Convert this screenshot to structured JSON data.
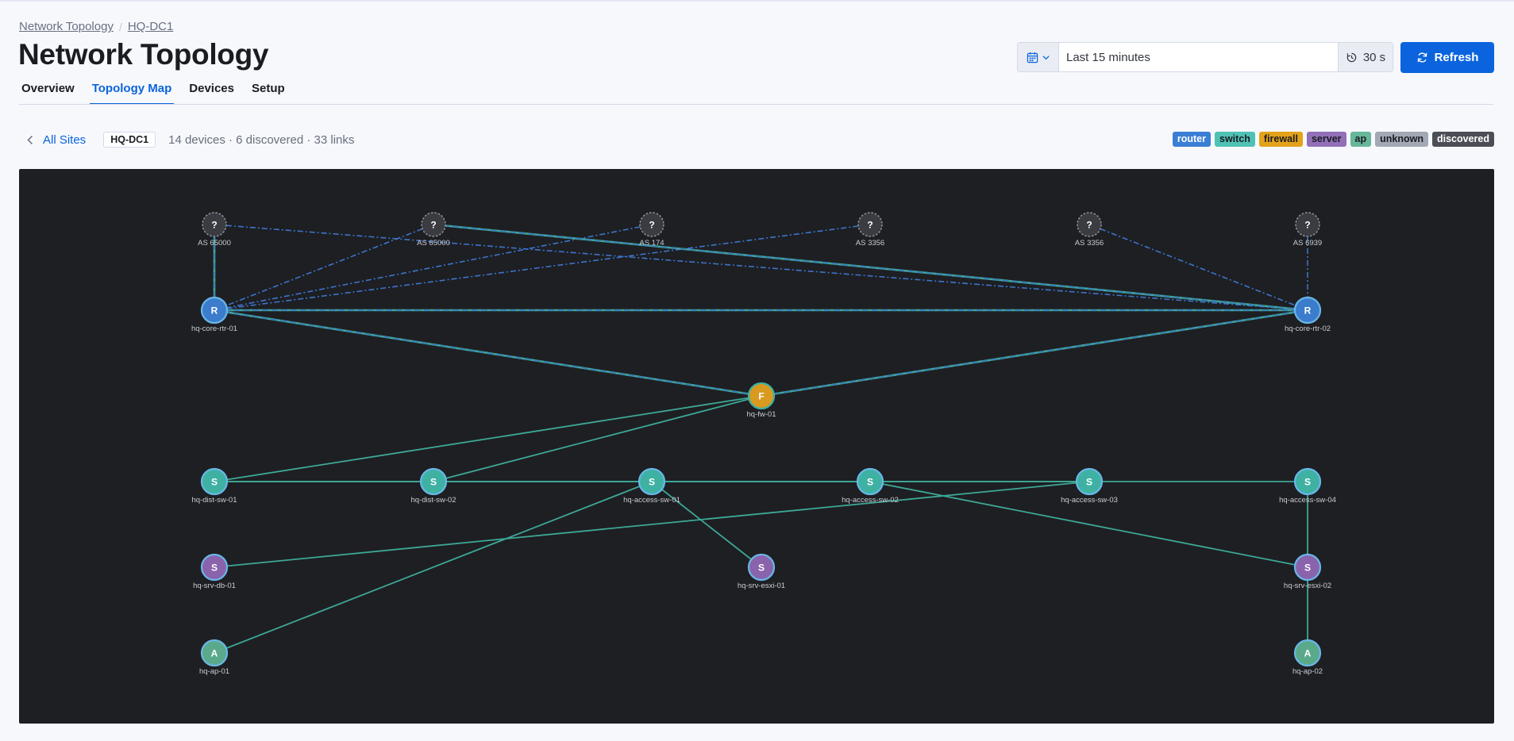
{
  "breadcrumb": {
    "root": "Network Topology",
    "current": "HQ-DC1"
  },
  "page": {
    "title": "Network Topology"
  },
  "tabs": [
    {
      "label": "Overview"
    },
    {
      "label": "Topology Map",
      "active": true
    },
    {
      "label": "Devices"
    },
    {
      "label": "Setup"
    }
  ],
  "time_picker": {
    "range": "Last 15 minutes",
    "interval": "30 s",
    "calendar_icon": "calendar-icon",
    "refresh_interval_icon": "timer-icon"
  },
  "refresh_button": {
    "label": "Refresh",
    "icon": "refresh-icon"
  },
  "site_bar": {
    "back_label": "All Sites",
    "site": "HQ-DC1",
    "summary": "14 devices · 6 discovered · 33 links"
  },
  "legend": [
    {
      "label": "router",
      "bg": "#3a7fd5",
      "fg": "#ffffff"
    },
    {
      "label": "switch",
      "bg": "#4fc1b5",
      "fg": "#1a1c21"
    },
    {
      "label": "firewall",
      "bg": "#e3a21a",
      "fg": "#1a1c21"
    },
    {
      "label": "server",
      "bg": "#9170b8",
      "fg": "#1a1c21"
    },
    {
      "label": "ap",
      "bg": "#67b79a",
      "fg": "#1a1c21"
    },
    {
      "label": "unknown",
      "bg": "#a2a9b5",
      "fg": "#1a1c21"
    },
    {
      "label": "discovered",
      "bg": "#4b4e55",
      "fg": "#ffffff"
    }
  ],
  "colors": {
    "router": "#3b7ccc",
    "switch": "#3fb1a3",
    "firewall": "#d99a1f",
    "server": "#8a63ad",
    "ap": "#5aa98b",
    "discovered": "#3a3c42",
    "link_physical": "#3da896",
    "link_bgp": "#3c74c8",
    "accent": "#0b64dd"
  },
  "topology": {
    "nodes": [
      {
        "id": "as1",
        "label": "AS 65000",
        "glyph": "?",
        "type": "discovered"
      },
      {
        "id": "as2",
        "label": "AS 65000",
        "glyph": "?",
        "type": "discovered"
      },
      {
        "id": "as3",
        "label": "AS 174",
        "glyph": "?",
        "type": "discovered"
      },
      {
        "id": "as4",
        "label": "AS 3356",
        "glyph": "?",
        "type": "discovered"
      },
      {
        "id": "as5",
        "label": "AS 3356",
        "glyph": "?",
        "type": "discovered"
      },
      {
        "id": "as6",
        "label": "AS 6939",
        "glyph": "?",
        "type": "discovered"
      },
      {
        "id": "r1",
        "label": "hq-core-rtr-01",
        "glyph": "R",
        "type": "router"
      },
      {
        "id": "r2",
        "label": "hq-core-rtr-02",
        "glyph": "R",
        "type": "router"
      },
      {
        "id": "fw",
        "label": "hq-fw-01",
        "glyph": "F",
        "type": "firewall"
      },
      {
        "id": "ds1",
        "label": "hq-dist-sw-01",
        "glyph": "S",
        "type": "switch"
      },
      {
        "id": "ds2",
        "label": "hq-dist-sw-02",
        "glyph": "S",
        "type": "switch"
      },
      {
        "id": "as01",
        "label": "hq-access-sw-01",
        "glyph": "S",
        "type": "switch"
      },
      {
        "id": "as02",
        "label": "hq-access-sw-02",
        "glyph": "S",
        "type": "switch"
      },
      {
        "id": "as03",
        "label": "hq-access-sw-03",
        "glyph": "S",
        "type": "switch"
      },
      {
        "id": "as04",
        "label": "hq-access-sw-04",
        "glyph": "S",
        "type": "switch"
      },
      {
        "id": "db1",
        "label": "hq-srv-db-01",
        "glyph": "S",
        "type": "server"
      },
      {
        "id": "esx1",
        "label": "hq-srv-esxi-01",
        "glyph": "S",
        "type": "server"
      },
      {
        "id": "esx2",
        "label": "hq-srv-esxi-02",
        "glyph": "S",
        "type": "server"
      },
      {
        "id": "ap1",
        "label": "hq-ap-01",
        "glyph": "A",
        "type": "ap"
      },
      {
        "id": "ap2",
        "label": "hq-ap-02",
        "glyph": "A",
        "type": "ap"
      }
    ],
    "links": [
      {
        "from": "as1",
        "to": "r1",
        "kind": "bgp"
      },
      {
        "from": "as1",
        "to": "r2",
        "kind": "bgp"
      },
      {
        "from": "as2",
        "to": "r1",
        "kind": "bgp"
      },
      {
        "from": "as2",
        "to": "r2",
        "kind": "bgp"
      },
      {
        "from": "as3",
        "to": "r1",
        "kind": "bgp"
      },
      {
        "from": "as4",
        "to": "r1",
        "kind": "bgp"
      },
      {
        "from": "as5",
        "to": "r2",
        "kind": "bgp"
      },
      {
        "from": "as6",
        "to": "r2",
        "kind": "bgp"
      },
      {
        "from": "as1",
        "to": "r1",
        "kind": "ha"
      },
      {
        "from": "as2",
        "to": "r2",
        "kind": "ha"
      },
      {
        "from": "r1",
        "to": "r2",
        "kind": "ha"
      },
      {
        "from": "r1",
        "to": "fw",
        "kind": "ha"
      },
      {
        "from": "r2",
        "to": "fw",
        "kind": "ha"
      },
      {
        "from": "fw",
        "to": "ds1",
        "kind": "phys"
      },
      {
        "from": "fw",
        "to": "ds2",
        "kind": "phys"
      },
      {
        "from": "ds1",
        "to": "ds2",
        "kind": "phys"
      },
      {
        "from": "ds2",
        "to": "as01",
        "kind": "phys"
      },
      {
        "from": "as01",
        "to": "as02",
        "kind": "phys"
      },
      {
        "from": "as02",
        "to": "as03",
        "kind": "phys"
      },
      {
        "from": "as03",
        "to": "as04",
        "kind": "phys"
      },
      {
        "from": "ds1",
        "to": "as01",
        "kind": "phys"
      },
      {
        "from": "ds2",
        "to": "as02",
        "kind": "phys"
      },
      {
        "from": "as01",
        "to": "as03",
        "kind": "phys"
      },
      {
        "from": "ds1",
        "to": "as02",
        "kind": "phys"
      },
      {
        "from": "as01",
        "to": "esx1",
        "kind": "phys"
      },
      {
        "from": "as01",
        "to": "ap1",
        "kind": "phys"
      },
      {
        "from": "as03",
        "to": "db1",
        "kind": "phys"
      },
      {
        "from": "as02",
        "to": "esx2",
        "kind": "phys"
      },
      {
        "from": "as04",
        "to": "esx2",
        "kind": "phys"
      },
      {
        "from": "esx2",
        "to": "ap2",
        "kind": "phys"
      }
    ]
  }
}
